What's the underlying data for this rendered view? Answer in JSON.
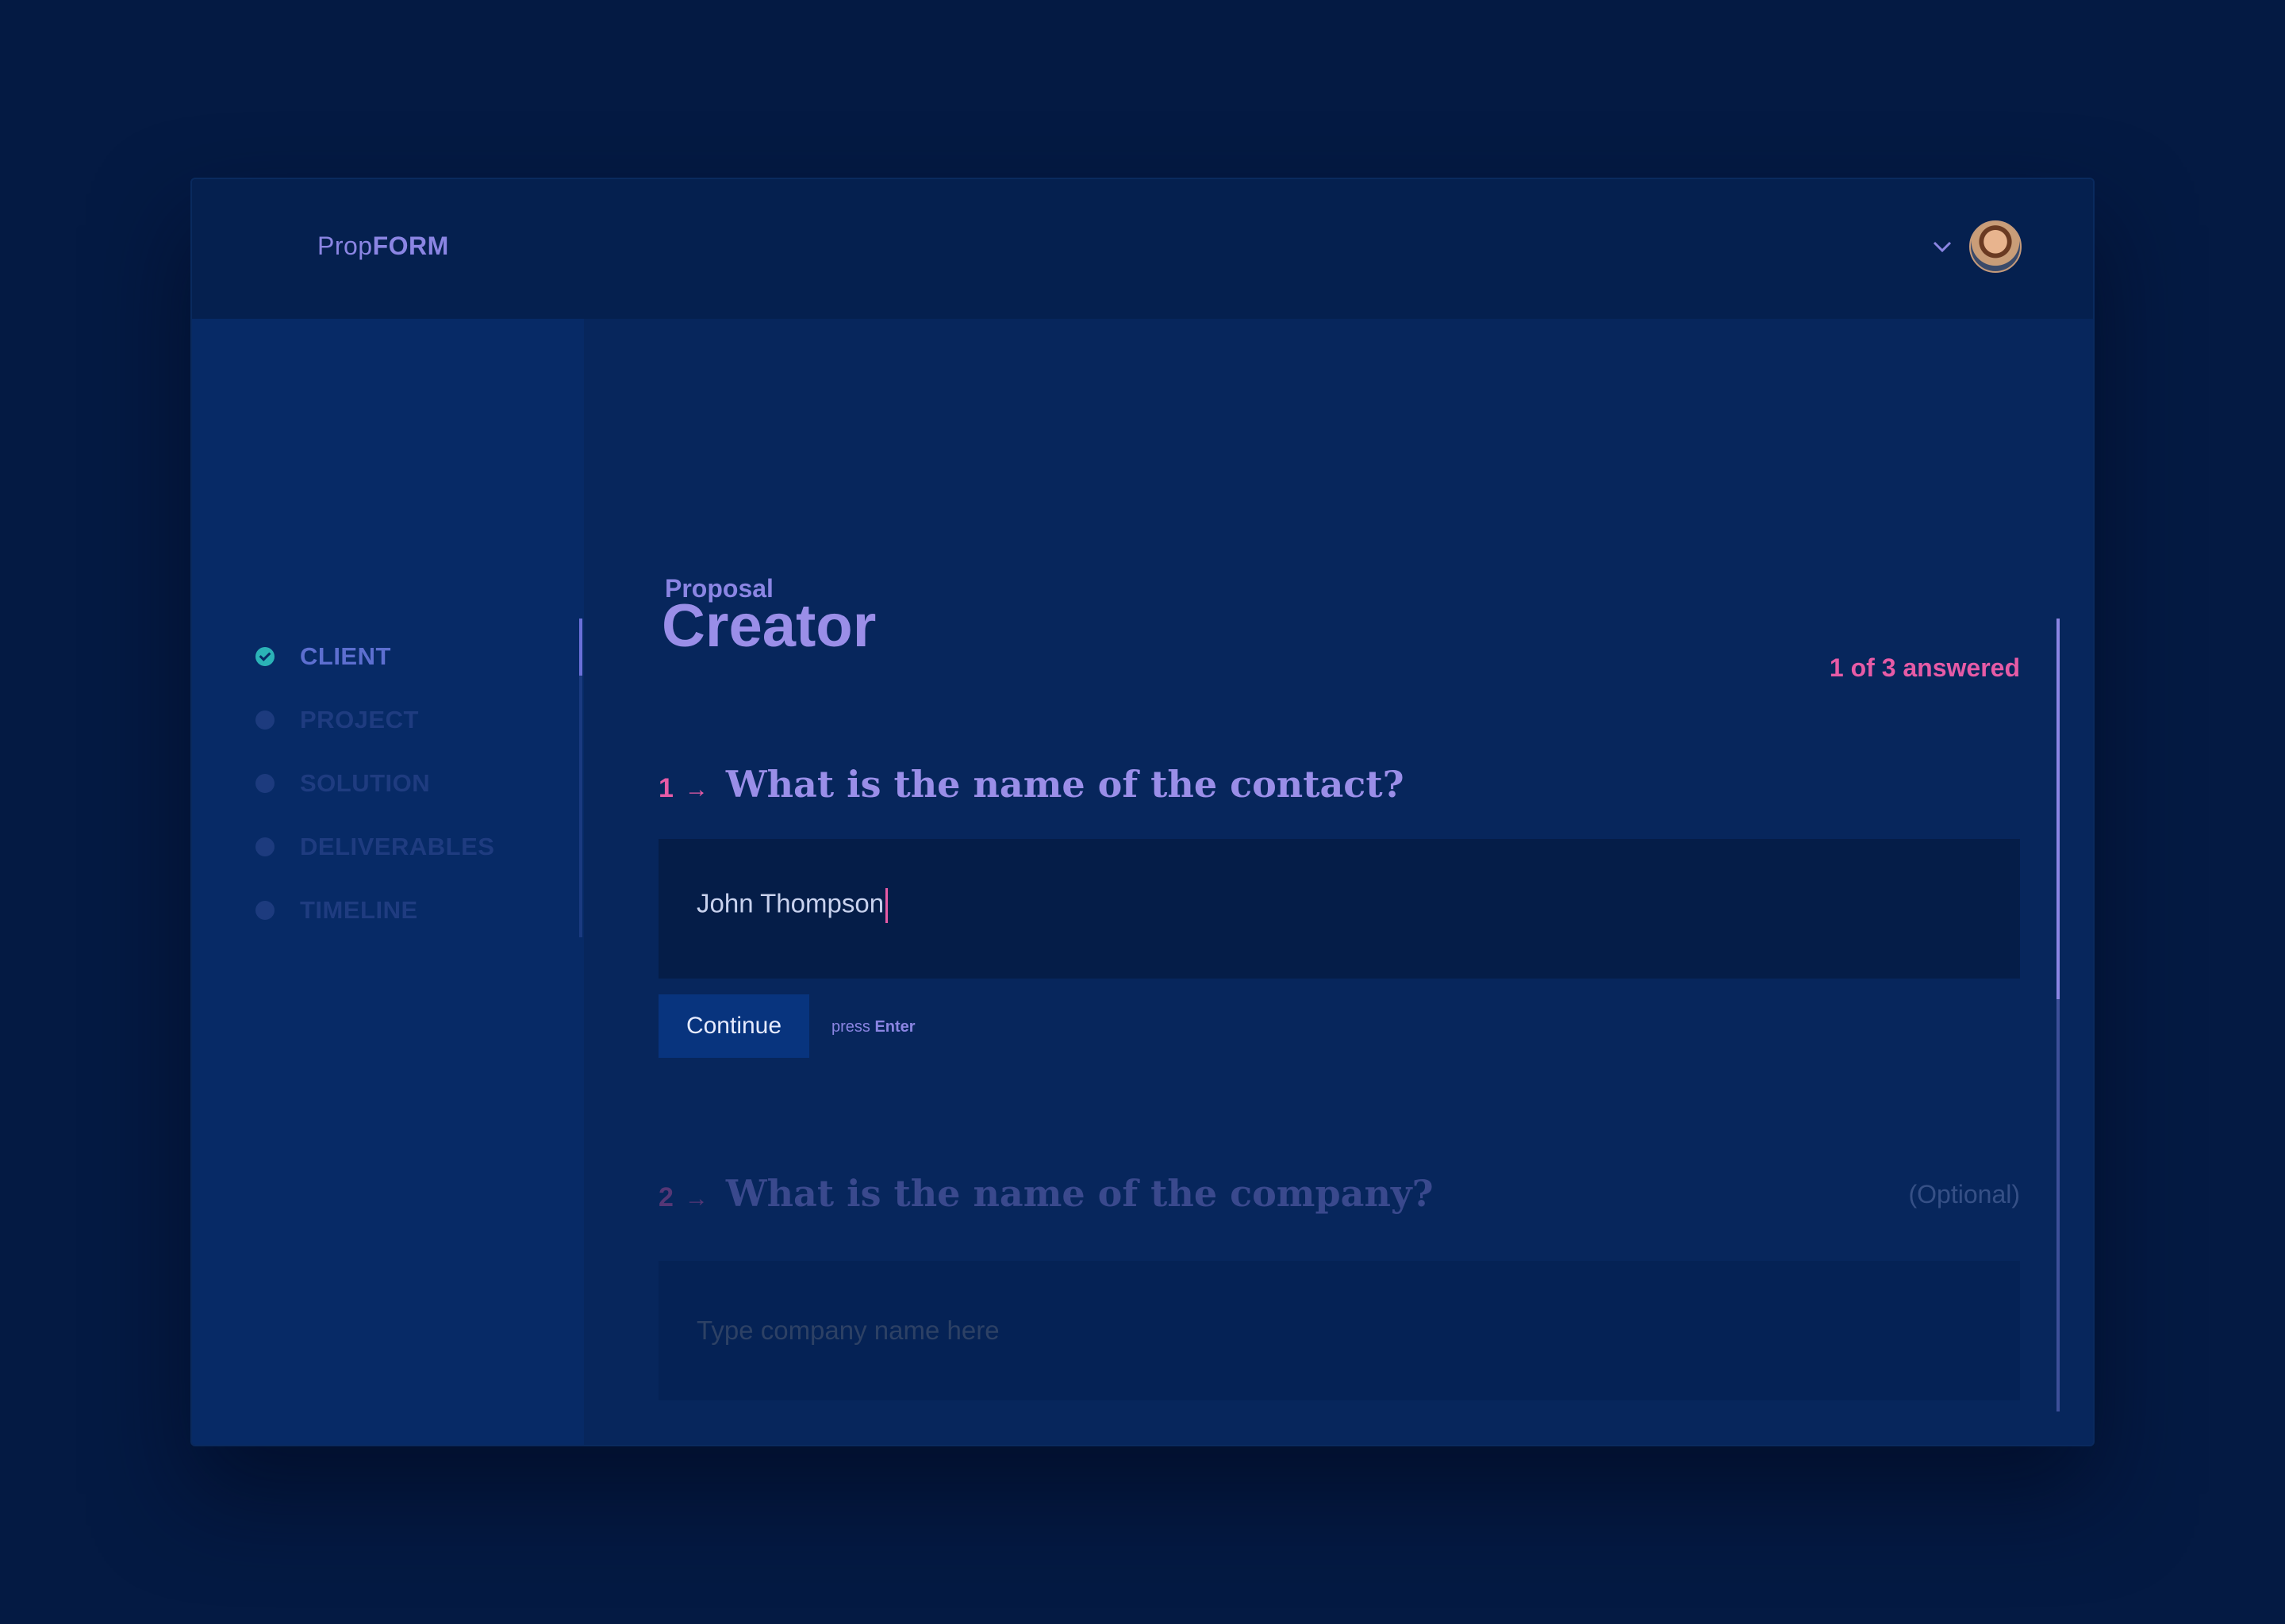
{
  "brand": {
    "prefix": "Prop",
    "suffix": "FORM"
  },
  "header": {
    "user_menu_icon": "chevron-down-icon",
    "avatar": "user-avatar"
  },
  "sidebar": {
    "steps": [
      {
        "label": "CLIENT",
        "state": "done",
        "icon": "check-circle-icon"
      },
      {
        "label": "PROJECT",
        "state": "pending"
      },
      {
        "label": "SOLUTION",
        "state": "pending"
      },
      {
        "label": "DELIVERABLES",
        "state": "pending"
      },
      {
        "label": "TIMELINE",
        "state": "pending"
      }
    ]
  },
  "page": {
    "kicker": "Proposal",
    "title": "Creator",
    "progress": "1 of 3 answered"
  },
  "questions": [
    {
      "number": "1",
      "arrow": "→",
      "title": "What is the name of the contact?",
      "value": "John Thompson",
      "continue_label": "Continue",
      "hint_prefix": "press",
      "hint_key": "Enter"
    },
    {
      "number": "2",
      "arrow": "→",
      "title": "What is the name of the company?",
      "optional": "(Optional)",
      "placeholder": "Type company name here"
    }
  ],
  "colors": {
    "background": "#041a43",
    "accent_pink": "#e75ba6",
    "accent_purple": "#8b85e3",
    "check_teal": "#2bb3b7"
  }
}
